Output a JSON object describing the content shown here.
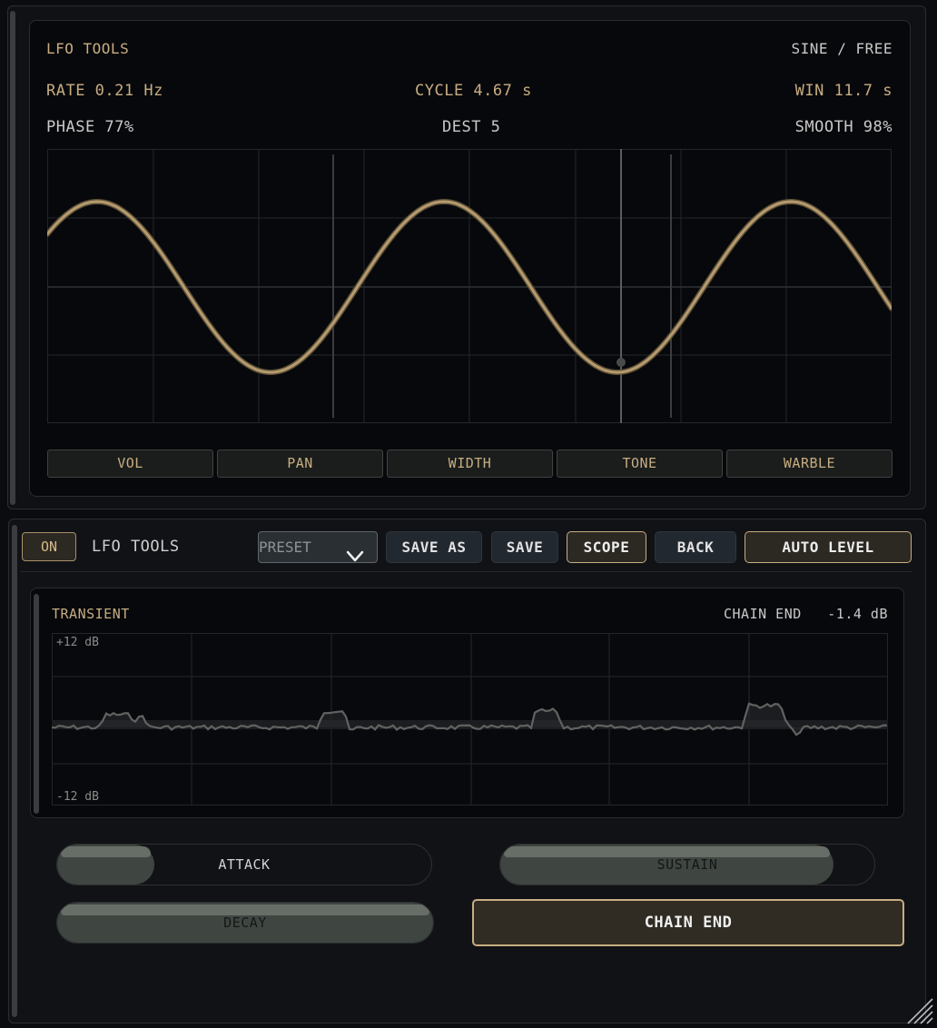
{
  "lfo": {
    "title": "LFO TOOLS",
    "mode": "SINE / FREE",
    "rate": "RATE 0.21 Hz",
    "cycle": "CYCLE 4.67 s",
    "win": "WIN 11.7 s",
    "phase": "PHASE 77%",
    "dest": "DEST 5",
    "smooth": "SMOOTH 98%",
    "destinations": [
      "VOL",
      "PAN",
      "WIDTH",
      "TONE",
      "WARBLE"
    ]
  },
  "toolbar": {
    "on_label": "ON",
    "title": "LFO TOOLS",
    "preset_label": "PRESET",
    "save_as": "SAVE AS",
    "save": "SAVE",
    "scope": "SCOPE",
    "back": "BACK",
    "auto_level": "AUTO LEVEL"
  },
  "transient": {
    "title": "TRANSIENT",
    "chain_label": "CHAIN END",
    "chain_value": "-1.4 dB",
    "top_label": "+12 dB",
    "bottom_label": "-12 dB"
  },
  "controls": {
    "attack": {
      "label": "ATTACK",
      "value": 0.26
    },
    "sustain": {
      "label": "SUSTAIN",
      "value": 0.89
    },
    "decay": {
      "label": "DECAY",
      "value": 1.0
    },
    "chain_end": "CHAIN END"
  },
  "colors": {
    "accent": "#c7ad82",
    "wave": "#b59b6e"
  }
}
